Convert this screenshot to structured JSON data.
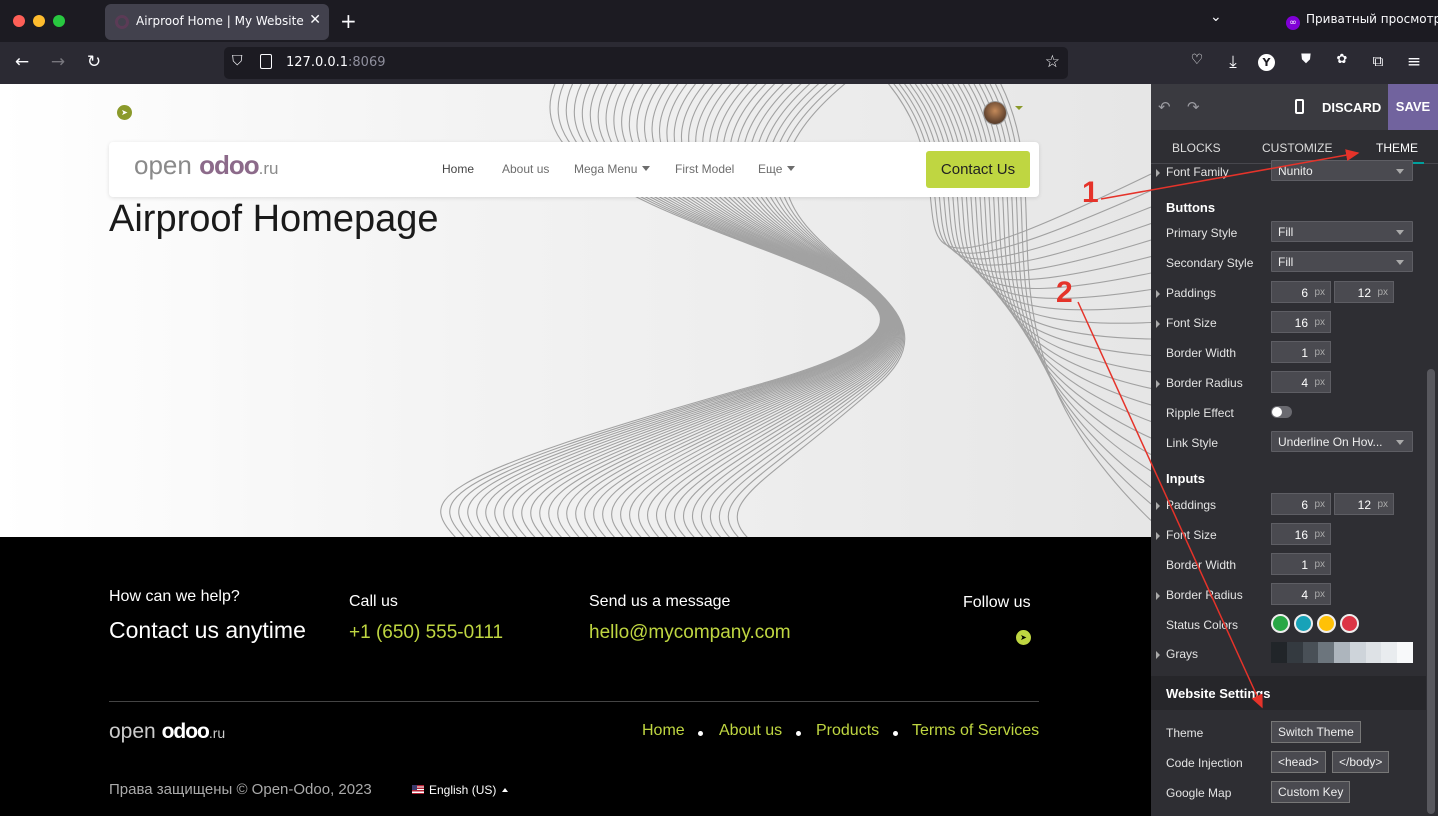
{
  "browser": {
    "tab_title": "Airproof Home | My Website",
    "private_label": "Приватный просмотр",
    "url_host": "127.0.0.1",
    "url_port": ":8069"
  },
  "site": {
    "logo": {
      "prefix": "open ",
      "brand": "odoo",
      "suffix": ".ru"
    },
    "menu": [
      "Home",
      "About us",
      "Mega Menu",
      "First Model",
      "Еще"
    ],
    "contact_button": "Contact Us",
    "page_title": "Airproof Homepage",
    "footer": {
      "help_heading": "How can we help?",
      "help_text": "Contact us anytime",
      "call_heading": "Call us",
      "phone": "+1 (650) 555-0111",
      "message_heading": "Send us a message",
      "email": "hello@mycompany.com",
      "follow_heading": "Follow us",
      "links": [
        "Home",
        "About us",
        "Products",
        "Terms of Services"
      ],
      "copyright": "Права защищены © Open-Odoo, 2023",
      "language": "English (US)"
    }
  },
  "editor": {
    "discard": "DISCARD",
    "save": "SAVE",
    "tabs": [
      "BLOCKS",
      "CUSTOMIZE",
      "THEME"
    ],
    "active_tab": "THEME",
    "font_family": {
      "label": "Font Family",
      "value": "Nunito"
    },
    "buttons_section": "Buttons",
    "primary_style": {
      "label": "Primary Style",
      "value": "Fill"
    },
    "secondary_style": {
      "label": "Secondary Style",
      "value": "Fill"
    },
    "btn_paddings": {
      "label": "Paddings",
      "y": "6",
      "x": "12",
      "unit": "px"
    },
    "btn_font_size": {
      "label": "Font Size",
      "value": "16",
      "unit": "px"
    },
    "btn_border_width": {
      "label": "Border Width",
      "value": "1",
      "unit": "px"
    },
    "btn_border_radius": {
      "label": "Border Radius",
      "value": "4",
      "unit": "px"
    },
    "ripple_effect": {
      "label": "Ripple Effect",
      "on": false
    },
    "link_style": {
      "label": "Link Style",
      "value": "Underline On Hov..."
    },
    "inputs_section": "Inputs",
    "in_paddings": {
      "label": "Paddings",
      "y": "6",
      "x": "12",
      "unit": "px"
    },
    "in_font_size": {
      "label": "Font Size",
      "value": "16",
      "unit": "px"
    },
    "in_border_width": {
      "label": "Border Width",
      "value": "1",
      "unit": "px"
    },
    "in_border_radius": {
      "label": "Border Radius",
      "value": "4",
      "unit": "px"
    },
    "status_colors": {
      "label": "Status Colors",
      "colors": [
        "#28a745",
        "#17a2b8",
        "#ffc107",
        "#dc3545"
      ]
    },
    "grays": {
      "label": "Grays",
      "colors": [
        "#212529",
        "#343a40",
        "#495057",
        "#6c757d",
        "#adb5bd",
        "#ced4da",
        "#dee2e6",
        "#e9ecef",
        "#f8f9fa"
      ]
    },
    "website_settings": "Website Settings",
    "theme": {
      "label": "Theme",
      "button": "Switch Theme"
    },
    "code_injection": {
      "label": "Code Injection",
      "head": "<head>",
      "body": "</body>"
    },
    "google_map": {
      "label": "Google Map",
      "button": "Custom Key"
    }
  },
  "annotations": {
    "one": "1",
    "two": "2"
  }
}
